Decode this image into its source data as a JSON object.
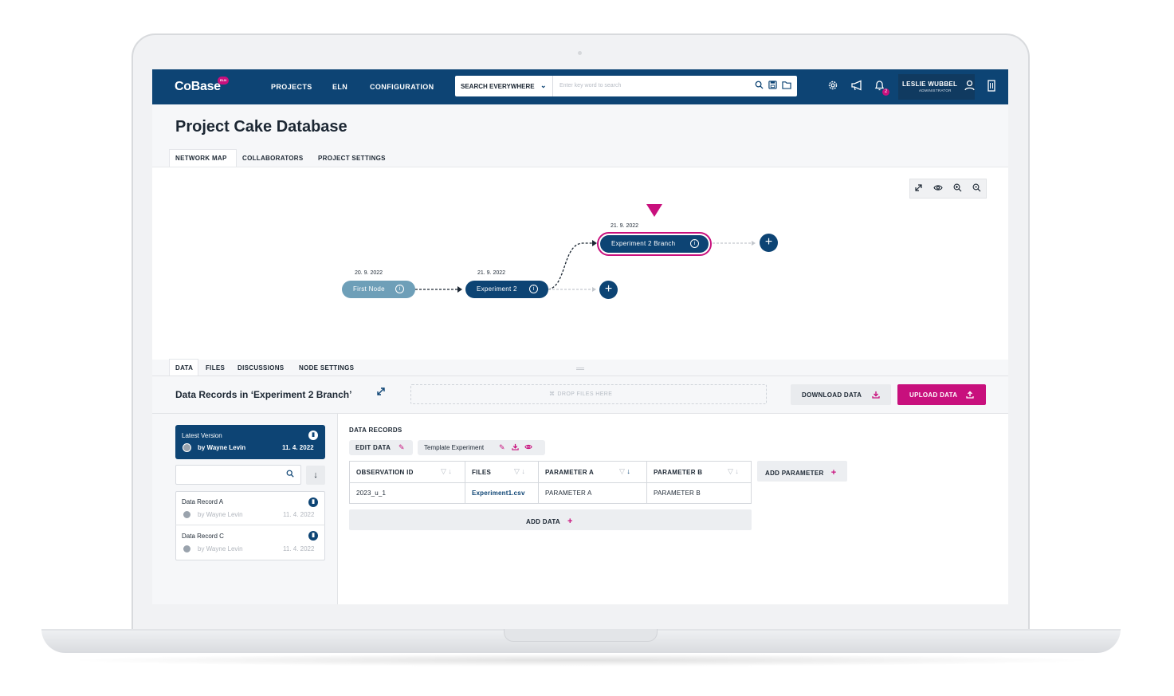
{
  "header": {
    "logo": "CoBase",
    "logo_badge": "ELN",
    "nav": [
      "PROJECTS",
      "ELN",
      "CONFIGURATION"
    ],
    "search_scope": "SEARCH EVERYWHERE",
    "search_placeholder": "Enter key word to search",
    "notification_count": "2",
    "user_name": "LESLIE WUBBEL",
    "user_role": "ADMINISTRATOR"
  },
  "page": {
    "title": "Project Cake Database",
    "tabs": [
      "NETWORK MAP",
      "COLLABORATORS",
      "PROJECT SETTINGS"
    ],
    "active_tab": "NETWORK MAP"
  },
  "network_map": {
    "nodes": [
      {
        "label": "First Node",
        "date": "20. 9. 2022",
        "color": "#6e9fb8"
      },
      {
        "label": "Experiment 2",
        "date": "21. 9. 2022",
        "color": "#0d4474"
      },
      {
        "label": "Experiment 2 Branch",
        "date": "21. 9. 2022",
        "color": "#0d4474",
        "selected": true
      }
    ],
    "tools": [
      "expand-icon",
      "eye-icon",
      "zoom-in-icon",
      "zoom-out-icon"
    ]
  },
  "node_tabs": [
    "DATA",
    "FILES",
    "DISCUSSIONS",
    "NODE SETTINGS"
  ],
  "records": {
    "title": "Data Records in ‘Experiment 2 Branch’",
    "dropzone": "DROP FILES HERE",
    "download_label": "DOWNLOAD DATA",
    "upload_label": "UPLOAD DATA"
  },
  "versions": {
    "latest": {
      "title": "Latest Version",
      "by": "by Wayne Levin",
      "date": "11. 4. 2022"
    },
    "items": [
      {
        "name": "Data Record A",
        "by": "by Wayne Levin",
        "date": "11. 4. 2022"
      },
      {
        "name": "Data Record C",
        "by": "by Wayne Levin",
        "date": "11. 4. 2022"
      }
    ]
  },
  "data_records": {
    "label": "DATA RECORDS",
    "edit_label": "EDIT DATA",
    "template_label": "Template Experiment",
    "columns": [
      "OBSERVATION ID",
      "FILES",
      "PARAMETER A",
      "PARAMETER B"
    ],
    "rows": [
      [
        "2023_u_1",
        "Experiment1.csv",
        "PARAMETER A",
        "PARAMETER B"
      ]
    ],
    "add_parameter_label": "ADD PARAMETER",
    "add_data_label": "ADD DATA"
  },
  "colors": {
    "brand_navy": "#0d4474",
    "accent_magenta": "#c8107d"
  }
}
